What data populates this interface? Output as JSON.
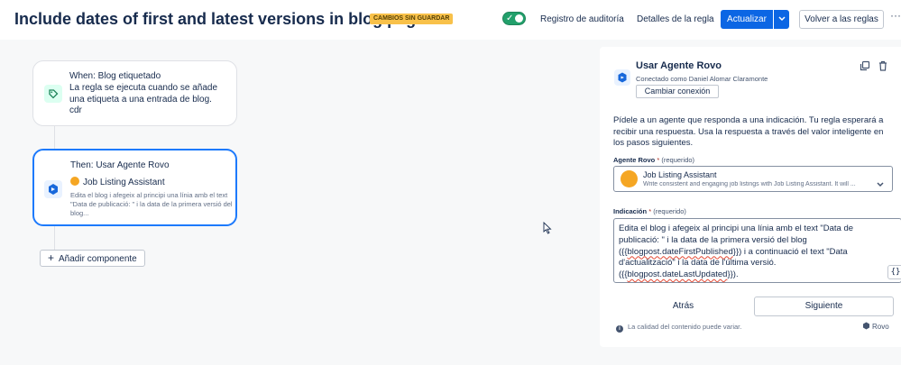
{
  "header": {
    "title": "Include dates of first and latest versions in blog pages",
    "unsaved_badge": "CAMBIOS SIN GUARDAR",
    "audit_label": "Registro de auditoría",
    "details_label": "Detalles de la regla",
    "update_label": "Actualizar",
    "back_label": "Volver a las reglas",
    "more_label": "···",
    "toggle_check": "✓"
  },
  "canvas": {
    "trigger": {
      "title": "When: Blog etiquetado",
      "description": "La regla se ejecuta cuando se añade una etiqueta a una entrada de blog.",
      "tag": "cdr"
    },
    "action": {
      "title": "Then: Usar Agente Rovo",
      "agent": "Job Listing Assistant",
      "preview": "Edita el blog i afegeix al principi una línia amb el text \"Data de publicació: \" i la data de la primera versió del blog..."
    },
    "add_component_label": "Añadir componente",
    "add_component_plus": "+"
  },
  "panel": {
    "title": "Usar Agente Rovo",
    "connected_as": "Conectado como Daniel Alomar Claramonte",
    "change_connection": "Cambiar conexión",
    "intro": "Pídele a un agente que responda a una indicación. Tu regla esperará a recibir una respuesta. Usa la respuesta a través del valor inteligente en los pasos siguientes.",
    "agent_field": {
      "label": "Agente Rovo",
      "required_mark": "*",
      "required_text": "(requerido)",
      "selected_name": "Job Listing Assistant",
      "selected_desc": "Write consistent and engaging job listings with Job Listing Assistant. It will ..."
    },
    "prompt_field": {
      "label": "Indicación",
      "required_mark": "*",
      "required_text": "(requerido)",
      "text_part1": "Edita el blog i afegeix al principi una línia amb el text \"Data de publicació: \" i la data de la primera versió del blog ({{",
      "smart1": "blogpost.dateFirstPublished",
      "text_part2": "}}) i a continuació el text \"Data d'actualització\" i la data de l'última versió. ({{",
      "smart2": "blogpost.dateLastUpdated",
      "text_part3": "}}).",
      "braces_label": "{}"
    },
    "back_label": "Atrás",
    "next_label": "Siguiente",
    "quality_note": "La calidad del contenido puede variar.",
    "info_glyph": "i",
    "rovo_label": "Rovo"
  },
  "colors": {
    "primary": "#0c66e4",
    "toggle_on": "#22a06b",
    "unsaved_badge": "#f8c14a",
    "agent_avatar": "#f5a623",
    "selected_border": "#1d7afc"
  },
  "icons": [
    "tag-icon",
    "rovo-icon",
    "copy-icon",
    "trash-icon",
    "chevron-down-icon",
    "plus-icon",
    "info-icon",
    "mouse-cursor-icon"
  ]
}
